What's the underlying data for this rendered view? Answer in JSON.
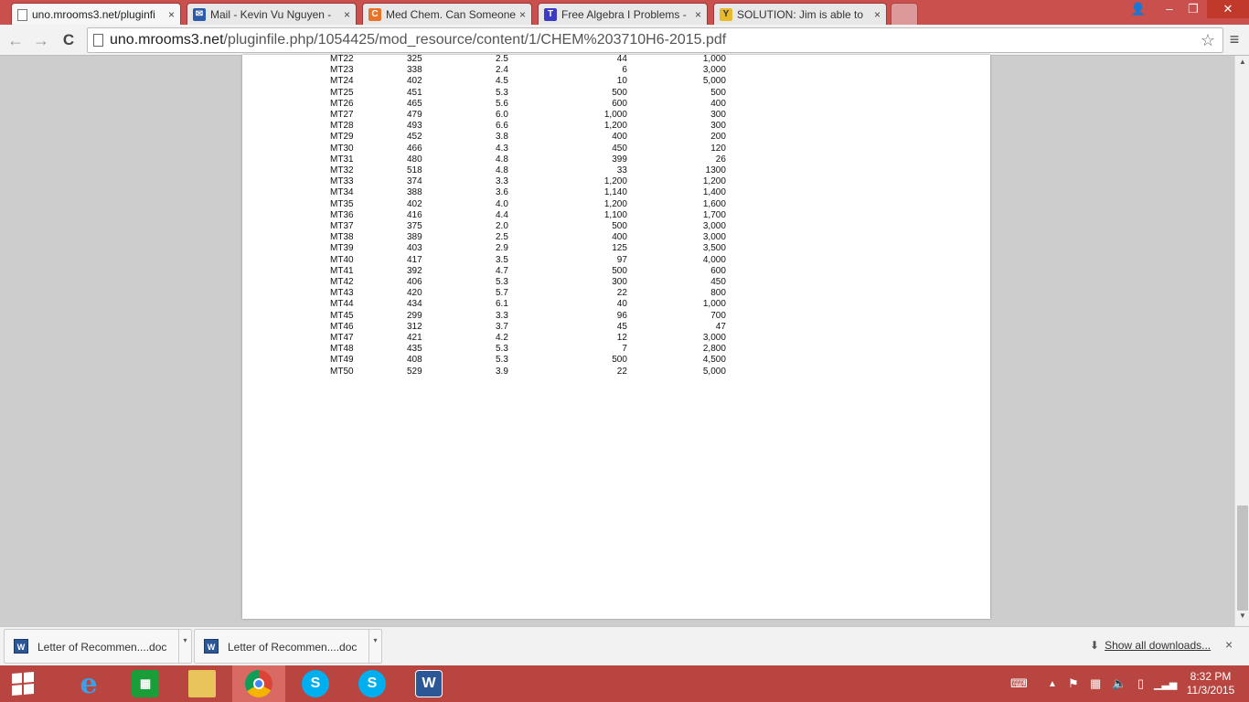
{
  "browser": {
    "tabs": [
      {
        "title": "uno.mrooms3.net/pluginfi",
        "icon": "document-icon",
        "active": true
      },
      {
        "title": "Mail - Kevin Vu Nguyen -",
        "icon": "mail-icon",
        "active": false
      },
      {
        "title": "Med Chem. Can Someone",
        "icon": "chegg-icon",
        "active": false
      },
      {
        "title": "Free Algebra I Problems -",
        "icon": "t-icon",
        "active": false
      },
      {
        "title": "SOLUTION: Jim is able to",
        "icon": "ya-icon",
        "active": false
      }
    ],
    "address": {
      "host": "uno.mrooms3.net",
      "path": "/pluginfile.php/1054425/mod_resource/content/1/CHEM%203710H6-2015.pdf"
    },
    "buttons": {
      "back": "←",
      "forward": "→",
      "reload": "C",
      "star": "☆",
      "menu": "≡",
      "close_tab": "×"
    },
    "window_buttons": {
      "profile": "👤",
      "minimize": "–",
      "restore": "❐",
      "close": "✕"
    }
  },
  "pdf": {
    "rows": [
      [
        "MT22",
        "325",
        "2.5",
        "44",
        "1,000"
      ],
      [
        "MT23",
        "338",
        "2.4",
        "6",
        "3,000"
      ],
      [
        "MT24",
        "402",
        "4.5",
        "10",
        "5,000"
      ],
      [
        "MT25",
        "451",
        "5.3",
        "500",
        "500"
      ],
      [
        "MT26",
        "465",
        "5.6",
        "600",
        "400"
      ],
      [
        "MT27",
        "479",
        "6.0",
        "1,000",
        "300"
      ],
      [
        "MT28",
        "493",
        "6.6",
        "1,200",
        "300"
      ],
      [
        "MT29",
        "452",
        "3.8",
        "400",
        "200"
      ],
      [
        "MT30",
        "466",
        "4.3",
        "450",
        "120"
      ],
      [
        "MT31",
        "480",
        "4.8",
        "399",
        "26"
      ],
      [
        "MT32",
        "518",
        "4.8",
        "33",
        "1300"
      ],
      [
        "MT33",
        "374",
        "3.3",
        "1,200",
        "1,200"
      ],
      [
        "MT34",
        "388",
        "3.6",
        "1,140",
        "1,400"
      ],
      [
        "MT35",
        "402",
        "4.0",
        "1,200",
        "1,600"
      ],
      [
        "MT36",
        "416",
        "4.4",
        "1,100",
        "1,700"
      ],
      [
        "MT37",
        "375",
        "2.0",
        "500",
        "3,000"
      ],
      [
        "MT38",
        "389",
        "2.5",
        "400",
        "3,000"
      ],
      [
        "MT39",
        "403",
        "2.9",
        "125",
        "3,500"
      ],
      [
        "MT40",
        "417",
        "3.5",
        "97",
        "4,000"
      ],
      [
        "MT41",
        "392",
        "4.7",
        "500",
        "600"
      ],
      [
        "MT42",
        "406",
        "5.3",
        "300",
        "450"
      ],
      [
        "MT43",
        "420",
        "5.7",
        "22",
        "800"
      ],
      [
        "MT44",
        "434",
        "6.1",
        "40",
        "1,000"
      ],
      [
        "MT45",
        "299",
        "3.3",
        "96",
        "700"
      ],
      [
        "MT46",
        "312",
        "3.7",
        "45",
        "47"
      ],
      [
        "MT47",
        "421",
        "4.2",
        "12",
        "3,000"
      ],
      [
        "MT48",
        "435",
        "5.3",
        "7",
        "2,800"
      ],
      [
        "MT49",
        "408",
        "5.3",
        "500",
        "4,500"
      ],
      [
        "MT50",
        "529",
        "3.9",
        "22",
        "5,000"
      ]
    ]
  },
  "downloads": {
    "items": [
      {
        "name": "Letter of Recommen....doc",
        "icon": "word-doc-icon",
        "icon_text": "W"
      },
      {
        "name": "Letter of Recommen....doc",
        "icon": "word-doc-icon",
        "icon_text": "W"
      }
    ],
    "show_all": "Show all downloads...",
    "close": "×"
  },
  "taskbar": {
    "apps": [
      "internet-explorer",
      "windows-store",
      "file-explorer",
      "chrome",
      "skype-1",
      "skype-2",
      "word"
    ],
    "clock_time": "8:32 PM",
    "clock_date": "11/3/2015"
  },
  "colors": {
    "titlebar": "#c9504c",
    "taskbar": "#b8453f"
  }
}
